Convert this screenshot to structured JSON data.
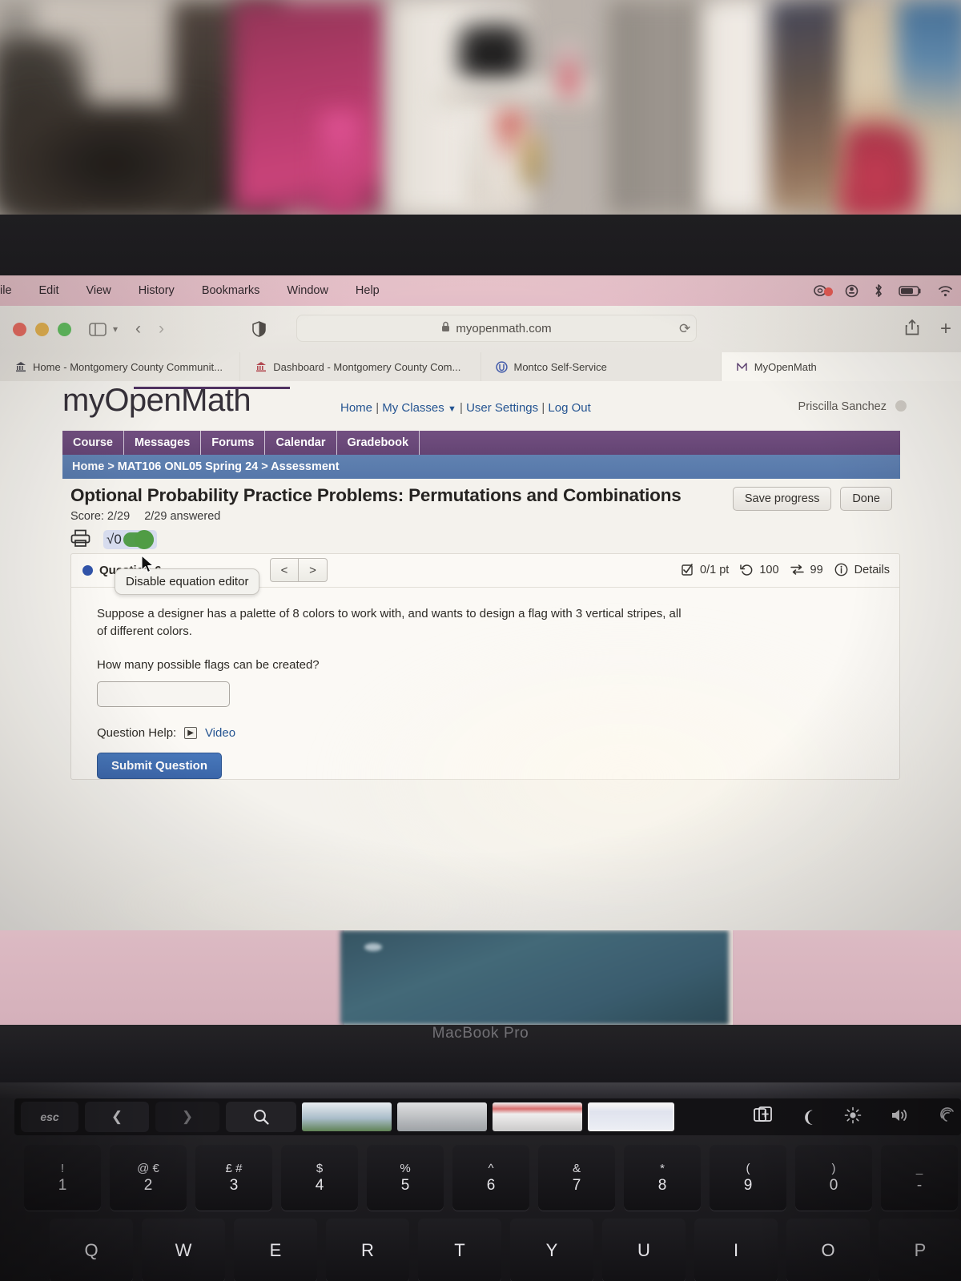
{
  "menubar": {
    "items": [
      "ile",
      "Edit",
      "View",
      "History",
      "Bookmarks",
      "Window",
      "Help"
    ],
    "status_icons": [
      "screen-recording-icon",
      "control-center-icon",
      "bluetooth-icon",
      "battery-icon",
      "wifi-icon"
    ]
  },
  "browser": {
    "url": "myopenmath.com",
    "lock_icon": "lock-icon",
    "reload_icon": "reload-icon",
    "shield_icon": "shield-icon",
    "sidebar_icon": "sidebar-icon",
    "chevron_icon": "chevron-down-icon",
    "back_icon": "back-arrow-icon",
    "forward_icon": "forward-arrow-icon",
    "share_icon": "share-icon",
    "newtab_icon": "plus-icon",
    "tabs": [
      {
        "title": "Home - Montgomery County Communit...",
        "icon": "montco-bank-icon",
        "active": false
      },
      {
        "title": "Dashboard - Montgomery County Com...",
        "icon": "montco-bank-icon",
        "active": false
      },
      {
        "title": "Montco Self-Service",
        "icon": "montco-self-service-icon",
        "active": false
      },
      {
        "title": "MyOpenMath",
        "icon": "myopenmath-m-icon",
        "active": true
      }
    ]
  },
  "site": {
    "logo": "myOpenMath",
    "nav": {
      "home": "Home",
      "my_classes": "My Classes",
      "user_settings": "User Settings",
      "log_out": "Log Out"
    },
    "user": "Priscilla Sanchez",
    "tabs": [
      "Course",
      "Messages",
      "Forums",
      "Calendar",
      "Gradebook"
    ],
    "breadcrumb": "Home > MAT106 ONL05 Spring 24 > Assessment",
    "colors": {
      "purple": "#5f3f70",
      "blue": "#4f74a8",
      "link": "#1d4f8f",
      "submit": "#3462a8"
    }
  },
  "assessment": {
    "title": "Optional Probability Practice Problems: Permutations and Combinations",
    "score_label": "Score: 2/29",
    "answered_label": "2/29 answered",
    "save_button": "Save progress",
    "done_button": "Done",
    "print_icon": "printer-icon",
    "equation_editor_symbol": "√0",
    "equation_editor_toggle": "on",
    "tooltip": "Disable equation editor"
  },
  "question": {
    "label": "Question 6",
    "prev_arrow": "<",
    "next_arrow": ">",
    "meta": {
      "points": "0/1 pt",
      "points_icon": "checkbox-icon",
      "attempts": "100",
      "attempts_icon": "undo-icon",
      "versions": "99",
      "versions_icon": "shuffle-icon",
      "details": "Details",
      "details_icon": "info-icon"
    },
    "prompt_line1": "Suppose a designer has a palette of 8 colors to work with, and wants to design a flag with 3 vertical stripes, all of different colors.",
    "prompt_line2": "How many possible flags can be created?",
    "answer_value": "",
    "help_label": "Question Help:",
    "help_video": "Video",
    "help_video_icon": "play-icon",
    "submit_button": "Submit Question"
  },
  "laptop": {
    "model_label": "MacBook Pro",
    "touchbar": {
      "esc": "esc",
      "back_icon": "chevron-left-icon",
      "forward_icon": "chevron-right-icon",
      "search_icon": "search-icon",
      "tabs_icon": "new-tab-icon",
      "mic_icon": "siri-icon",
      "brightness_icon": "brightness-icon",
      "volume_icon": "volume-icon",
      "touchid_icon": "touch-id-icon"
    },
    "keyboard": {
      "number_row": [
        {
          "upper": "!",
          "lower": "1"
        },
        {
          "upper": "@ €",
          "lower": "2"
        },
        {
          "upper": "£ #",
          "lower": "3"
        },
        {
          "upper": "$",
          "lower": "4"
        },
        {
          "upper": "%",
          "lower": "5"
        },
        {
          "upper": "^",
          "lower": "6"
        },
        {
          "upper": "&",
          "lower": "7"
        },
        {
          "upper": "*",
          "lower": "8"
        },
        {
          "upper": "(",
          "lower": "9"
        },
        {
          "upper": ")",
          "lower": "0"
        },
        {
          "upper": "_",
          "lower": "-"
        }
      ],
      "letter_row": [
        "Q",
        "W",
        "E",
        "R",
        "T",
        "Y",
        "U",
        "I",
        "O",
        "P"
      ]
    }
  }
}
